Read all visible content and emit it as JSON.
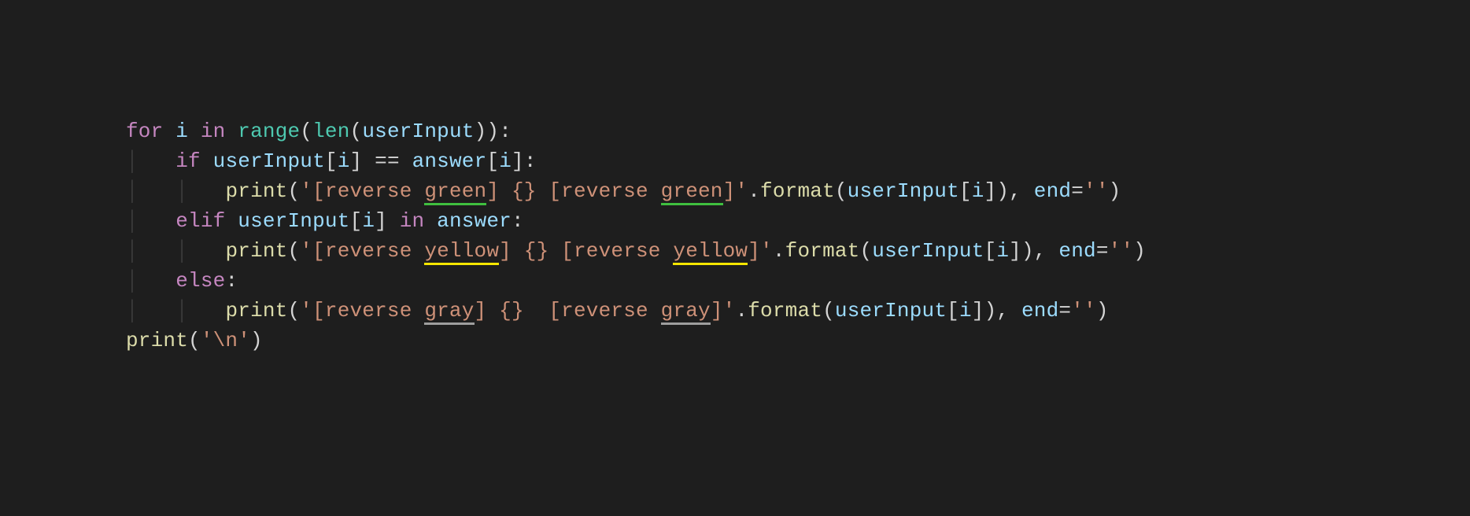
{
  "code": {
    "kw_for": "for",
    "var_i": "i",
    "kw_in": "in",
    "fn_range": "range",
    "fn_len": "len",
    "var_userInput": "userInput",
    "kw_if": "if",
    "op_eq": "==",
    "var_answer": "answer",
    "fn_print": "print",
    "str_rev1a": "'[reverse ",
    "str_green": "green",
    "str_rev1b": "] ",
    "str_placeholder": "{}",
    "str_rev1c": " [reverse ",
    "str_rev1d": "]'",
    "fn_format": "format",
    "var_end": "end",
    "str_empty": "''",
    "kw_elif": "elif",
    "str_yellow": "yellow",
    "kw_else": "else",
    "str_gray": "gray",
    "str_space": " ",
    "str_nl": "'\\n'",
    "paren_o": "(",
    "paren_c": ")",
    "brack_o": "[",
    "brack_c": "]",
    "comma": ",",
    "dot": ".",
    "colon": ":",
    "assign": "=",
    "guide": "│"
  }
}
